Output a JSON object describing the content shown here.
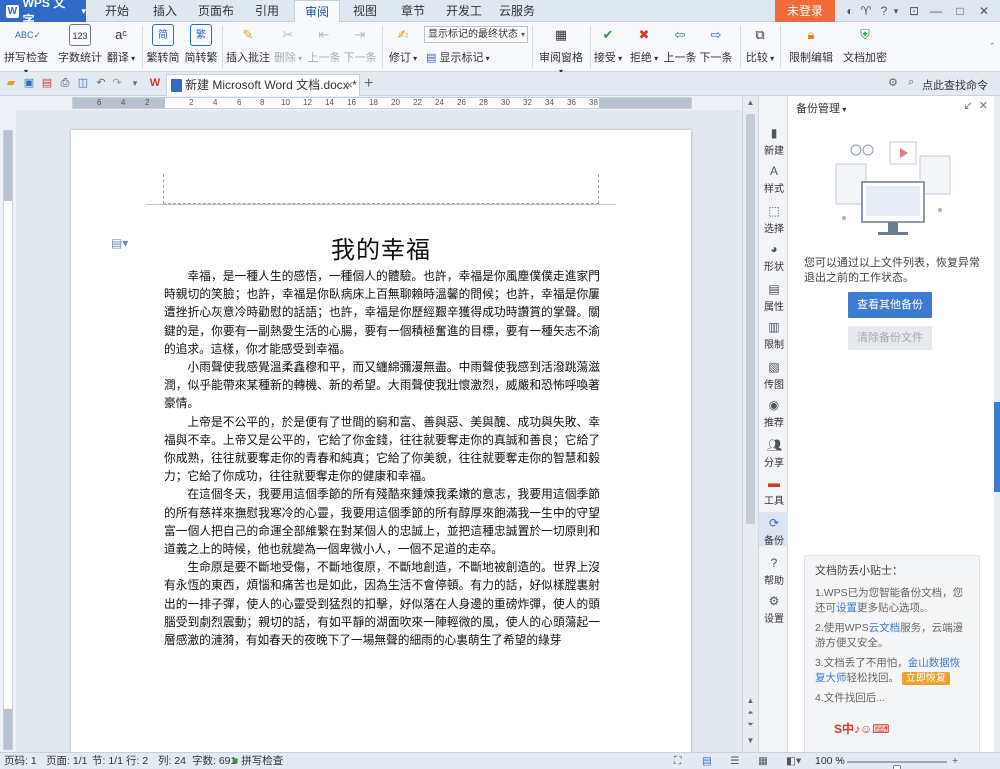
{
  "app": {
    "name": "WPS 文字",
    "login": "未登录"
  },
  "menu": [
    "开始",
    "插入",
    "页面布局",
    "引用",
    "审阅",
    "视图",
    "章节",
    "开发工具",
    "云服务"
  ],
  "active_menu": "审阅",
  "ribbon": {
    "spell_check": "拼写检查",
    "word_count": "字数统计",
    "translate": "翻译",
    "to_simplified": "繁转简",
    "to_traditional": "简转繁",
    "insert_comment": "插入批注",
    "delete": "删除",
    "prev": "上一条",
    "next": "下一条",
    "revise": "修订",
    "markup_mode": "显示标记的最终状态",
    "show_markup": "显示标记",
    "review_pane": "审阅窗格",
    "accept": "接受",
    "reject": "拒绝",
    "prev_change": "上一条",
    "next_change": "下一条",
    "compare": "比较",
    "restrict_edit": "限制编辑",
    "encrypt": "文档加密"
  },
  "tabbar": {
    "doc_name": "新建 Microsoft Word 文档.docx *",
    "find": "点此查找命令"
  },
  "ruler": [
    "6",
    "4",
    "2",
    "2",
    "4",
    "6",
    "8",
    "10",
    "12",
    "14",
    "16",
    "18",
    "20",
    "22",
    "24",
    "26",
    "28",
    "30",
    "32",
    "34",
    "36",
    "38"
  ],
  "document": {
    "title": "我的幸福",
    "paragraphs": [
      "幸福，是一種人生的感悟，一種個人的體驗。也許，幸福是你風塵僕僕走進家門時親切的笑臉；也許，幸福是你臥病床上百無聊賴時溫馨的問候；也許，幸福是你屢遭挫折心灰意冷時勸慰的話語；也許，幸福是你歷經艱辛獲得成功時讚賞的掌聲。關鍵的是，你要有一副熱愛生活的心腸，要有一個積極奮進的目標，要有一種矢志不渝的追求。這樣，你才能感受到幸福。",
      "小雨聲使我感覺溫柔鑫穆和平，而又纏綿彌漫無盡。中雨聲使我感到活潑跳蕩滋潤，似乎能帶來某種新的轉機、新的希望。大雨聲使我壯懷激烈，威嚴和恐怖呼喚著豪情。",
      "上帝是不公平的，於是便有了世間的窮和富、善與惡、美與醜、成功與失敗、幸福與不幸。上帝又是公平的，它給了你金錢，往往就要奪走你的真誠和善良；它給了你成熟，往往就要奪走你的青春和純真；它給了你美貌，往往就要奪走你的智慧和毅力；它給了你成功，往往就要奪走你的健康和幸福。",
      "在這個冬天，我要用這個季節的所有殘酷來鍾煉我柔嫩的意志，我要用這個季節的所有慈祥來撫慰我寒冷的心靈，我要用這個季節的所有醇厚來飽滿我一生中的守望富一個人把自己的命運全部維繫在對某個人的忠誠上，並把這種忠誠置於一切原則和道義之上的時候，他也就變為一個卑微小人，一個不足道的走卒。",
      "生命原是要不斷地受傷，不斷地復原，不斷地創造，不斷地被創造的。世界上沒有永恆的東西，煩惱和痛苦也是如此，因為生活不會停頓。有力的話，好似樣膛裏射出的一排子彈，使人的心靈受到猛烈的扣擊，好似落在人身邊的重磅炸彈，使人的頭腦受到劇烈震動；親切的話，有如平靜的湖面吹來一陣輕微的風，使人的心頭蕩起一層感激的漣漪，有如春天的夜晚下了一場無聲的細雨的心裏萌生了希望的綠芽"
    ]
  },
  "sidebar": [
    "新建",
    "样式",
    "选择",
    "形状",
    "属性",
    "限制",
    "传图",
    "推荐",
    "分享",
    "工具",
    "备份",
    "帮助",
    "设置"
  ],
  "sidebar_active": "备份",
  "panel": {
    "title": "备份管理",
    "desc": "您可以通过以上文件列表，恢复异常退出之前的工作状态。",
    "view_btn": "查看其他备份",
    "clear_btn": "清除备份文件",
    "tips_title": "文档防丢小贴士：",
    "tip1_a": "1.WPS已为您智能备份文档，您还可",
    "tip1_link": "设置",
    "tip1_b": "更多贴心选项。",
    "tip2_a": "2.使用WPS",
    "tip2_link": "云文档",
    "tip2_b": "服务，云端漫游方便又安全。",
    "tip3_a": "3.文档丢了不用怕，",
    "tip3_link": "金山数据恢复大师",
    "tip3_b": "轻松找回。",
    "tip3_tag": "立即恢复",
    "tip4": "4.文件找回后..."
  },
  "status": {
    "page_no": "页码: 1",
    "pages": "页面: 1/1",
    "section": "节: 1/1",
    "row": "行: 2",
    "col": "列: 24",
    "words": "字数: 691",
    "spell": "拼写检查",
    "zoom": "100 %",
    "zoom_level": 0.5
  },
  "colors": {
    "accent": "#2f6bc6",
    "login": "#ef6b3a",
    "button": "#3d7ad1"
  }
}
